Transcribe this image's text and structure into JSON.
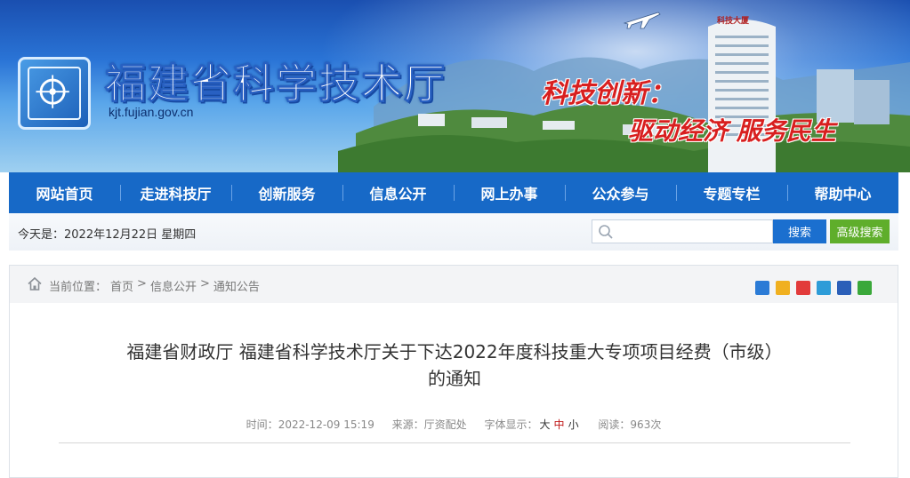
{
  "site": {
    "title": "福建省科学技术厅",
    "url": "kjt.fujian.gov.cn",
    "slogan_line1": "科技创新：",
    "slogan_line2": "驱动经济 服务民生",
    "tower_label": "科技大厦"
  },
  "nav": {
    "items": [
      {
        "label": "网站首页"
      },
      {
        "label": "走进科技厅"
      },
      {
        "label": "创新服务"
      },
      {
        "label": "信息公开"
      },
      {
        "label": "网上办事"
      },
      {
        "label": "公众参与"
      },
      {
        "label": "专题专栏"
      },
      {
        "label": "帮助中心"
      }
    ]
  },
  "info_bar": {
    "date_text": "今天是：2022年12月22日  星期四",
    "search_placeholder": "",
    "search_button": "搜索",
    "advanced_button": "高级搜索"
  },
  "breadcrumb": {
    "prefix": "当前位置：",
    "items": [
      "首页",
      "信息公开",
      "通知公告"
    ],
    "separator": ">"
  },
  "share_icons": [
    "add-icon",
    "qzone-icon",
    "weibo-icon",
    "pengyou-icon",
    "renren-icon",
    "wechat-icon"
  ],
  "share_colors": [
    "#2b7bd6",
    "#f0b020",
    "#e23b3b",
    "#2d9cd8",
    "#2b5fb8",
    "#3aa83a"
  ],
  "article": {
    "title_line1": "福建省财政厅 福建省科学技术厅关于下达2022年度科技重大专项项目经费（市级）",
    "title_line2": "的通知",
    "time_label": "时间：",
    "time_value": "2022-12-09 15:19",
    "source_label": "来源：",
    "source_value": "厅资配处",
    "font_label": "字体显示：",
    "font_sizes": [
      "大",
      "中",
      "小"
    ],
    "active_font_size": "中",
    "views_label": "阅读：",
    "views_value": "963次"
  },
  "colors": {
    "nav_bg": "#1769c7",
    "search_btn": "#1b6fcf",
    "advanced_btn": "#5fae2b",
    "slogan": "#d81f1f"
  }
}
